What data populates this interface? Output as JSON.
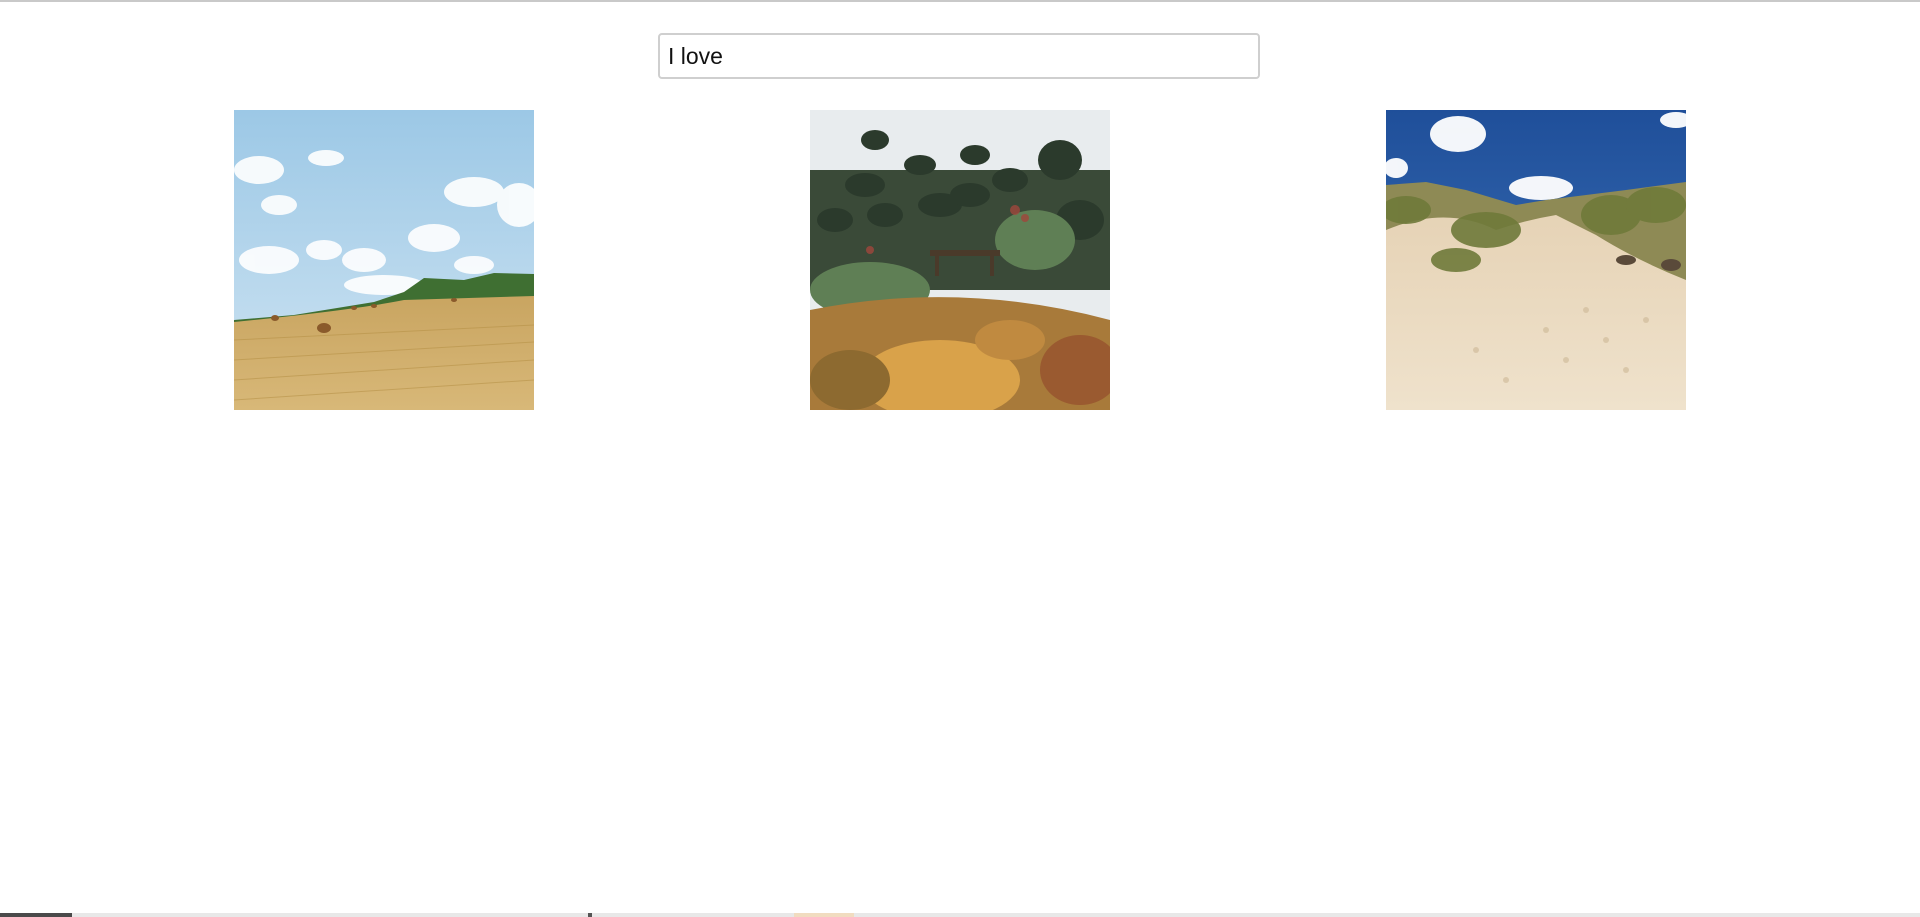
{
  "search": {
    "value": "I love",
    "placeholder": ""
  },
  "gallery": {
    "images": [
      {
        "subject": "hay-field-with-bales",
        "alt": ""
      },
      {
        "subject": "autumn-garden-with-cloud-pruned-trees",
        "alt": ""
      },
      {
        "subject": "sand-dunes-with-grass",
        "alt": ""
      }
    ]
  },
  "colors": {
    "page_background": "#ffffff",
    "input_border": "#cfcfcf",
    "text": "#111111"
  }
}
